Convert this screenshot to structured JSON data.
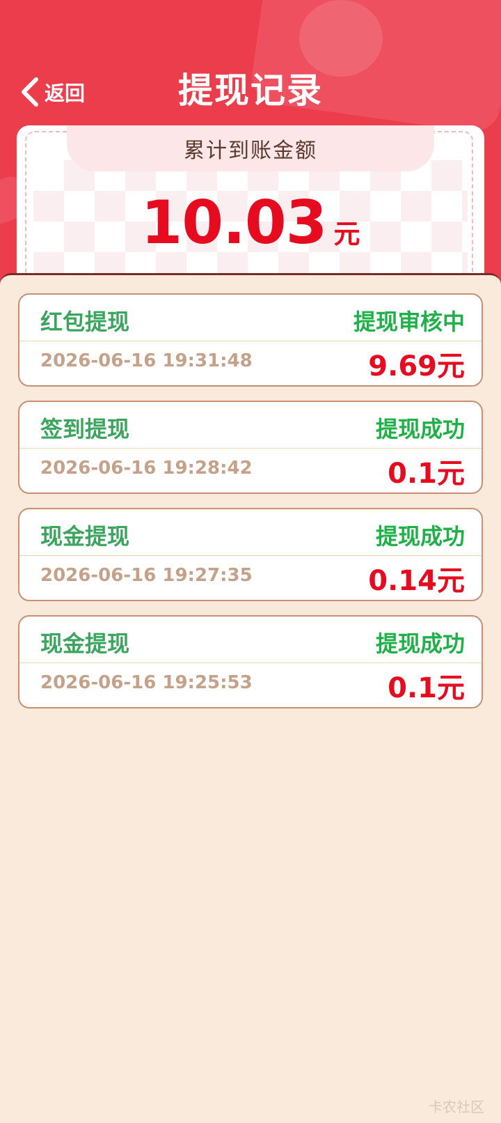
{
  "header": {
    "back_label": "返回",
    "title": "提现记录"
  },
  "summary": {
    "label": "累计到账金额",
    "amount": "10.03",
    "unit": "元"
  },
  "records": [
    {
      "type": "红包提现",
      "status": "提现审核中",
      "time": "2026-06-16 19:31:48",
      "amount": "9.69元"
    },
    {
      "type": "签到提现",
      "status": "提现成功",
      "time": "2026-06-16 19:28:42",
      "amount": "0.1元"
    },
    {
      "type": "现金提现",
      "status": "提现成功",
      "time": "2026-06-16 19:27:35",
      "amount": "0.14元"
    },
    {
      "type": "现金提现",
      "status": "提现成功",
      "time": "2026-06-16 19:25:53",
      "amount": "0.1元"
    }
  ],
  "watermark": "卡农社区",
  "colors": {
    "header_red": "#ec3d4d",
    "amount_red": "#e60b1f",
    "status_green": "#1fb048",
    "panel_bg": "#faeadb"
  }
}
